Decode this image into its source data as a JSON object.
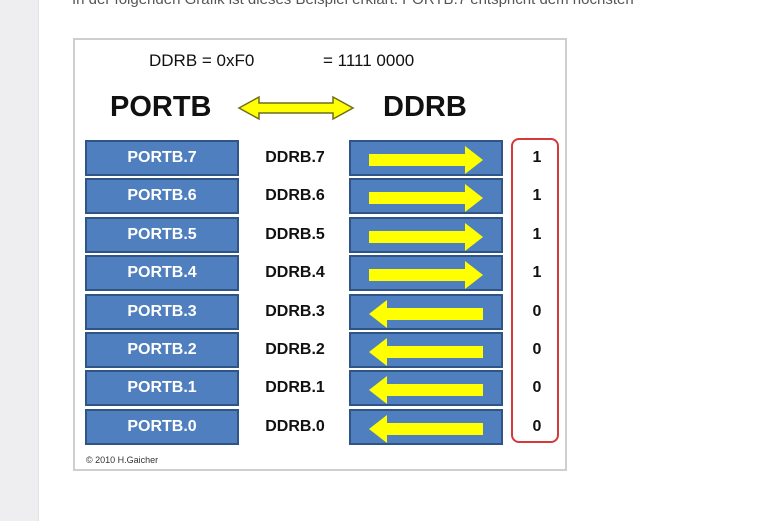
{
  "page": {
    "intro_text": "In der folgenden Grafik ist dieses Beispiel erklärt. PORTB.7 entspricht dem höchsten"
  },
  "figure": {
    "equation_left": "DDRB = 0xF0",
    "equation_right": "= 1111 0000",
    "heading_left": "PORTB",
    "heading_right": "DDRB",
    "copyright": "© 2010 H.Gaicher",
    "colors": {
      "box_fill": "#4f7fbe",
      "box_border": "#2f5587",
      "arrow_fill": "#ffff00",
      "frame": "#d43a3a"
    },
    "rows": [
      {
        "port": "PORTB.7",
        "ddr": "DDRB.7",
        "bit": "1",
        "arrow": "right"
      },
      {
        "port": "PORTB.6",
        "ddr": "DDRB.6",
        "bit": "1",
        "arrow": "right"
      },
      {
        "port": "PORTB.5",
        "ddr": "DDRB.5",
        "bit": "1",
        "arrow": "right"
      },
      {
        "port": "PORTB.4",
        "ddr": "DDRB.4",
        "bit": "1",
        "arrow": "right"
      },
      {
        "port": "PORTB.3",
        "ddr": "DDRB.3",
        "bit": "0",
        "arrow": "left"
      },
      {
        "port": "PORTB.2",
        "ddr": "DDRB.2",
        "bit": "0",
        "arrow": "left"
      },
      {
        "port": "PORTB.1",
        "ddr": "DDRB.1",
        "bit": "0",
        "arrow": "left"
      },
      {
        "port": "PORTB.0",
        "ddr": "DDRB.0",
        "bit": "0",
        "arrow": "left"
      }
    ]
  }
}
